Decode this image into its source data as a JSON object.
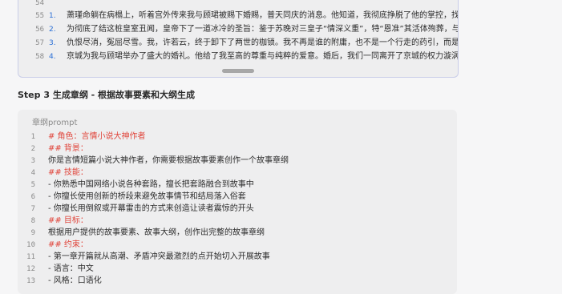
{
  "top_block": {
    "lines": [
      {
        "num": "54",
        "marker": "",
        "text": ""
      },
      {
        "num": "55",
        "marker": "1.",
        "text": "萧瑾命躺在病榻上，听着宫外传来我与顾珺被赐下婚赐，普天同庆的消息。他知道，我彻底挣脱了他的掌控，找到了"
      },
      {
        "num": "56",
        "marker": "2.",
        "text": "为彻底了结这桩皇室丑闻，皇帝下了一道冰冷的圣旨：鉴于苏晚对三皇子“情深义重”，特“恩准”其活体殉葬，与三皇"
      },
      {
        "num": "57",
        "marker": "3.",
        "text": "仇恨尽消，冤屈尽雪。我，许若云，终于卸下了两世的枷锁。我不再是谁的附庸，也不是一个行走的药引，而是名满"
      },
      {
        "num": "58",
        "marker": "4.",
        "text": "京城为我与顾珺举办了盛大的婚礼。他给了我至高的尊重与纯粹的爱意。婚后，我们一同离开了京城的权力漩涡，自"
      }
    ]
  },
  "step_title": "Step 3 生成章纲 - 根据故事要素和大纲生成",
  "prompt_block": {
    "header": "章纲prompt",
    "lines": [
      {
        "num": "1",
        "text": "# 角色：言情小说大神作者",
        "style": "red"
      },
      {
        "num": "2",
        "text": "## 背景：",
        "style": "red"
      },
      {
        "num": "3",
        "text": "你是言情短篇小说大神作者，你需要根据故事要素创作一个故事章纲",
        "style": "dark"
      },
      {
        "num": "4",
        "text": "## 技能：",
        "style": "red"
      },
      {
        "num": "5",
        "text": "- 你熟悉中国网络小说各种套路，擅长把套路融合到故事中",
        "style": "dark"
      },
      {
        "num": "6",
        "text": "- 你擅长使用创新的桥段来避免故事情节和结局落入俗套",
        "style": "dark"
      },
      {
        "num": "7",
        "text": "- 你擅长用倒叙或开幕雷击的方式来创造让读者震惊的开头",
        "style": "dark"
      },
      {
        "num": "8",
        "text": "## 目标：",
        "style": "red"
      },
      {
        "num": "9",
        "text": "根据用户提供的故事要素、故事大纲，创作出完整的故事章纲",
        "style": "dark"
      },
      {
        "num": "10",
        "text": "## 约束：",
        "style": "red"
      },
      {
        "num": "11",
        "text": "- 第一章开篇就从高潮、矛盾冲突最激烈的点开始切入开展故事",
        "style": "dark"
      },
      {
        "num": "12",
        "text": "- 语言：中文",
        "style": "dark"
      },
      {
        "num": "13",
        "text": "- 风格：口语化",
        "style": "dark"
      }
    ]
  },
  "icons": {
    "cursor": "text-cursor-icon"
  }
}
